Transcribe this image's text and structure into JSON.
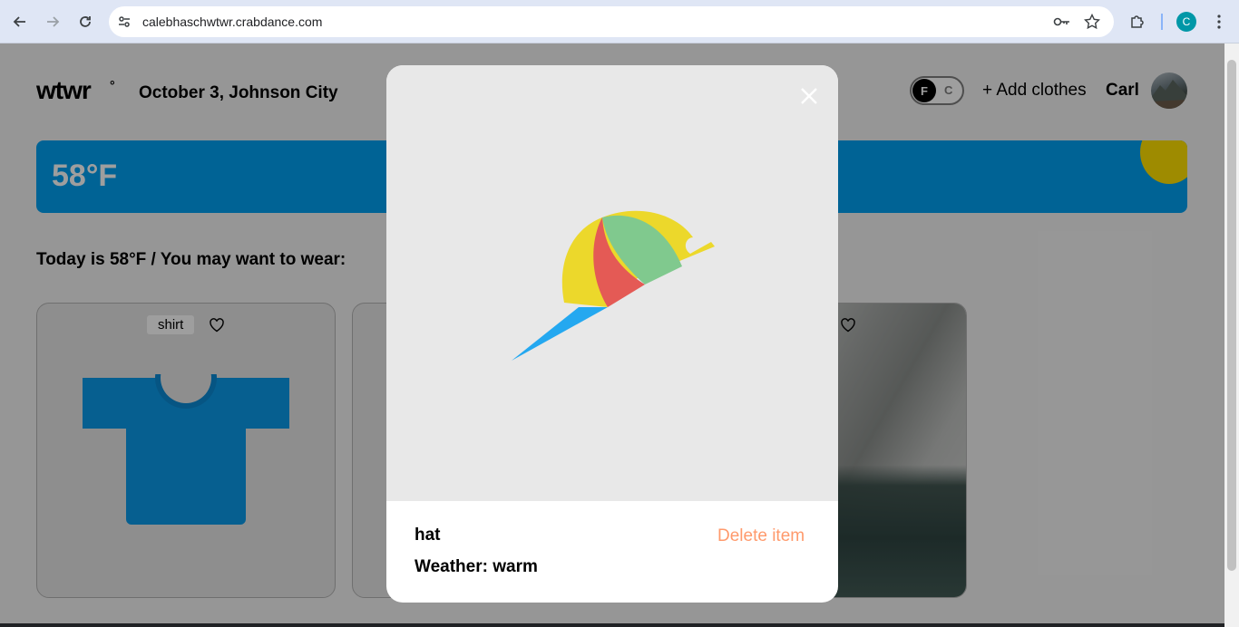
{
  "browser": {
    "url": "calebhaschwtwr.crabdance.com",
    "profile_initial": "C"
  },
  "header": {
    "logo": "wtwr",
    "logo_mark": "°",
    "date_location": "October 3, Johnson City",
    "toggle_f": "F",
    "toggle_c": "C",
    "add_clothes": "+ Add clothes",
    "user_name": "Carl"
  },
  "weather": {
    "temperature": "58°F"
  },
  "main": {
    "today_text": "Today is 58°F / You may want to wear:",
    "cards": [
      {
        "label": "shirt"
      }
    ]
  },
  "modal": {
    "item_name": "hat",
    "weather": "Weather: warm",
    "delete_label": "Delete item"
  },
  "colors": {
    "accent_blue": "#00a0f0",
    "sun_yellow": "#ffe000",
    "delete_orange": "#ff9a6c"
  }
}
